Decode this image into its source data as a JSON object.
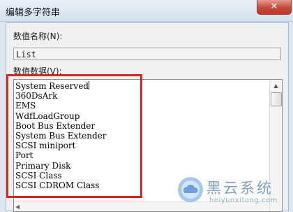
{
  "window": {
    "title": "编辑多字符串",
    "close_glyph": "✕"
  },
  "name_field": {
    "label": "数值名称(N):",
    "value": "List"
  },
  "value_field": {
    "label": "数值数据(V):",
    "lines": [
      "System Reserved",
      "360DsArk",
      "EMS",
      "WdfLoadGroup",
      "Boot Bus Extender",
      "System Bus Extender",
      "SCSI miniport",
      "Port",
      "Primary Disk",
      "SCSI Class",
      "SCSI CDROM Class"
    ],
    "scroll_up_glyph": "▲",
    "scroll_left_glyph": "◀"
  },
  "watermark": {
    "name": "黑云系统",
    "url": "heiyunxitong.com"
  },
  "colors": {
    "highlight_border": "#d7262a",
    "watermark": "#6a8fb8"
  }
}
